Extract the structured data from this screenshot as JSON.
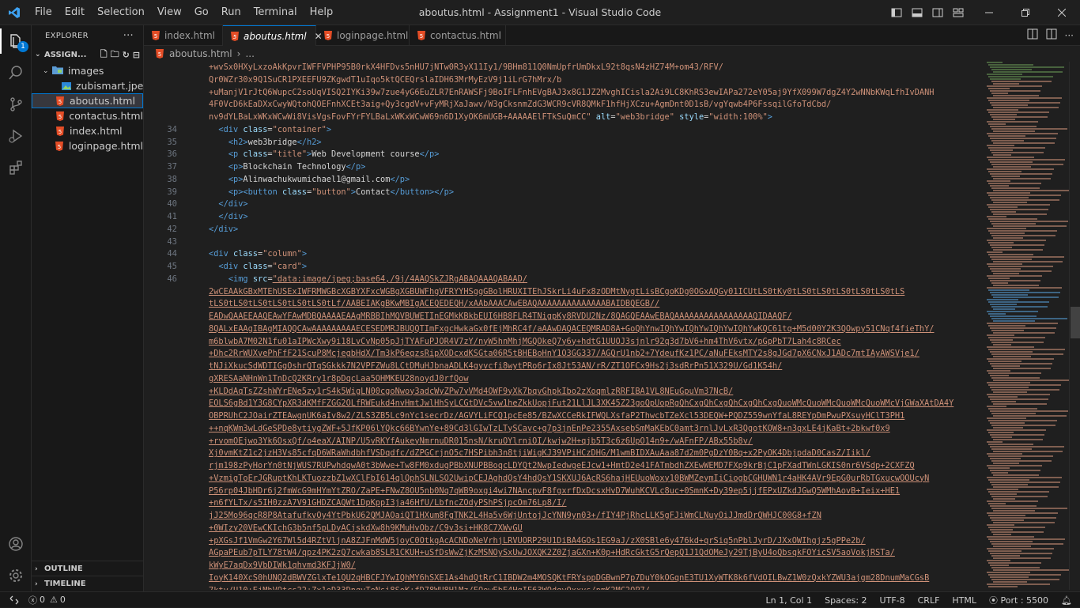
{
  "menu": [
    "File",
    "Edit",
    "Selection",
    "View",
    "Go",
    "Run",
    "Terminal",
    "Help"
  ],
  "window_title": "aboutus.html - Assignment1 - Visual Studio Code",
  "activitybar": {
    "badge": "1"
  },
  "explorer": {
    "header": "EXPLORER",
    "project": "ASSIGN...",
    "folder": "images",
    "items": [
      {
        "label": "zubismart.jpeg",
        "type": "image"
      },
      {
        "label": "aboutus.html",
        "type": "html",
        "selected": true
      },
      {
        "label": "contactus.html",
        "type": "html"
      },
      {
        "label": "index.html",
        "type": "html"
      },
      {
        "label": "loginpage.html",
        "type": "html"
      }
    ],
    "outline": "OUTLINE",
    "timeline": "TIMELINE"
  },
  "tabs": [
    {
      "label": "index.html",
      "active": false
    },
    {
      "label": "aboutus.html",
      "active": true
    },
    {
      "label": "loginpage.html",
      "active": false
    },
    {
      "label": "contactus.html",
      "active": false
    }
  ],
  "breadcrumb": {
    "file": "aboutus.html",
    "more": "..."
  },
  "code": {
    "lines": [
      {
        "n": "",
        "s": [
          [
            "str",
            "+wvSx0HXyLxzoAkKpvrIWFFVPHP95B0rkX4HFDvs5nHU7jNTw0R3yX11Iy1/9BHm811Q0NmUpfrUmDkxL92t8qsN4zHZ74M+om43/RFV/"
          ]
        ]
      },
      {
        "n": "",
        "s": [
          [
            "str",
            "Qr0WZr30x9Q1SuCR1PXEEFU9ZKgwdT1uIqo5ktQCEQrslaIDH63MrMyEzV9j1iLrG7hMrx/b"
          ]
        ]
      },
      {
        "n": "",
        "s": [
          [
            "str",
            "+uManjV1rJtQ6WupcC2soUqVISQ2IYKi39w7zue4yG6EuZLR7EnRAWSFj9BoIFLFnhEVgBAJ3x8G1JZ2MvghICisla2Ai9LC8KhRS3ewIAPa272eY05aj9YfX099W7dgZ4Y2wNNbKWqLfhIvDANH"
          ]
        ]
      },
      {
        "n": "",
        "s": [
          [
            "str",
            "4F0VcD6kEaDXxCwyWQtohQOEFnhXCEt3aig+Qy3cgdV+vFyMRjXaJawv/W3gCksnmZdG3WCR9cVR8QMkF1hfHjXCzu+AgmDnt0D1sB/vgYqwb4P6FssqilGfoTdCbd/"
          ]
        ]
      },
      {
        "n": "",
        "s": [
          [
            "str",
            "nv9dYLBaLxWKxWCwWi8VisVgsFovFYrFYLBaLxWKxWCwW69n6D1XyOK6mUGB+AAAAAElFTkSuQmCC\""
          ],
          [
            "att",
            " alt"
          ],
          [
            "txt",
            "="
          ],
          [
            "str",
            "\"web3bridge\""
          ],
          [
            "att",
            " style"
          ],
          [
            "txt",
            "="
          ],
          [
            "str",
            "\"width:100%\""
          ],
          [
            "tag",
            ">"
          ]
        ]
      },
      {
        "n": "34",
        "s": [
          [
            "txt",
            "  "
          ],
          [
            "tag",
            "<div"
          ],
          [
            "att",
            " class"
          ],
          [
            "txt",
            "="
          ],
          [
            "str",
            "\"container\""
          ],
          [
            "tag",
            ">"
          ]
        ]
      },
      {
        "n": "35",
        "s": [
          [
            "txt",
            "    "
          ],
          [
            "tag",
            "<h2>"
          ],
          [
            "txt",
            "web3bridge"
          ],
          [
            "tag",
            "</h2>"
          ]
        ]
      },
      {
        "n": "36",
        "s": [
          [
            "txt",
            "    "
          ],
          [
            "tag",
            "<p"
          ],
          [
            "att",
            " class"
          ],
          [
            "txt",
            "="
          ],
          [
            "str",
            "\"title\""
          ],
          [
            "tag",
            ">"
          ],
          [
            "txt",
            "Web Development course"
          ],
          [
            "tag",
            "</p>"
          ]
        ]
      },
      {
        "n": "37",
        "s": [
          [
            "txt",
            "    "
          ],
          [
            "tag",
            "<p>"
          ],
          [
            "txt",
            "Blockchain Technology"
          ],
          [
            "tag",
            "</p>"
          ]
        ]
      },
      {
        "n": "38",
        "s": [
          [
            "txt",
            "    "
          ],
          [
            "tag",
            "<p>"
          ],
          [
            "txt",
            "Alinwachukwumichael1@gmail.com"
          ],
          [
            "tag",
            "</p>"
          ]
        ]
      },
      {
        "n": "39",
        "s": [
          [
            "txt",
            "    "
          ],
          [
            "tag",
            "<p><button"
          ],
          [
            "att",
            " class"
          ],
          [
            "txt",
            "="
          ],
          [
            "str",
            "\"button\""
          ],
          [
            "tag",
            ">"
          ],
          [
            "txt",
            "Contact"
          ],
          [
            "tag",
            "</button></p>"
          ]
        ]
      },
      {
        "n": "40",
        "s": [
          [
            "txt",
            "  "
          ],
          [
            "tag",
            "</div>"
          ]
        ]
      },
      {
        "n": "41",
        "s": [
          [
            "txt",
            "  "
          ],
          [
            "tag",
            "</div>"
          ]
        ]
      },
      {
        "n": "42",
        "s": [
          [
            "txt",
            ""
          ],
          [
            "tag",
            "</div>"
          ]
        ]
      },
      {
        "n": "43",
        "s": [
          [
            "txt",
            ""
          ]
        ]
      },
      {
        "n": "44",
        "s": [
          [
            "txt",
            ""
          ],
          [
            "tag",
            "<div"
          ],
          [
            "att",
            " class"
          ],
          [
            "txt",
            "="
          ],
          [
            "str",
            "\"column\""
          ],
          [
            "tag",
            ">"
          ]
        ]
      },
      {
        "n": "45",
        "s": [
          [
            "txt",
            "  "
          ],
          [
            "tag",
            "<div"
          ],
          [
            "att",
            " class"
          ],
          [
            "txt",
            "="
          ],
          [
            "str",
            "\"card\""
          ],
          [
            "tag",
            ">"
          ]
        ]
      },
      {
        "n": "46",
        "s": [
          [
            "txt",
            "    "
          ],
          [
            "tag",
            "<img"
          ],
          [
            "att",
            " src"
          ],
          [
            "txt",
            "="
          ],
          [
            "ulink",
            "\"data:image/jpeg;base64,/9j/4AAQSkZJRgABAQAAAQABAAD/"
          ]
        ]
      },
      {
        "n": "",
        "s": [
          [
            "ulink",
            "2wCEAAkGBxMTEhUSExIWFRMWGBcXGBYXFxcWGBgXGBUWFhgVFRYYHSggGBolHRUXITEhJSkrLi4uFx8zODMtNygtLisBCgoKDg0OGxAQGy01ICUtLS0tKy0tLS0tLS0tLS0tLS0tLS0tLS"
          ]
        ]
      },
      {
        "n": "",
        "s": [
          [
            "ulink",
            "tLS0tLS0tLS0tLS0tLS0tLS0tLf/AABEIAKgBKwMBIgACEQEDEQH/xAAbAAACAwEBAQAAAAAAAAAAAAAABAIDBQEGB//"
          ]
        ]
      },
      {
        "n": "",
        "s": [
          [
            "ulink",
            "EADwQAAEEAAQEAwYFAwMDBQAAAAEAAgMRBBIhMQVBUWETInEGMkKBkbEUI6HB8FLR4TNigpKy8RVDU2Nz/8QAGQEAAwEBAQAAAAAAAAAAAAAAAAQIDAAQF/"
          ]
        ]
      },
      {
        "n": "",
        "s": [
          [
            "ulink",
            "8QALxEAAgIBAgMIAQQCAwAAAAAAAAAECESEDMRJBUQQTImFxgcHwkaGx0fEjMhRC4f/aAAwDAQACEQMRAD8A+GoQhYnwIQhYwIQhYwIQhYwIQhYwKQC61tq+M5d00Y2K3QOwpy51CNqf4fieThY/"
          ]
        ]
      },
      {
        "n": "",
        "s": [
          [
            "ulink",
            "m6blwbA7M02N1fu01aIPWcXwy9i18LvCvNp05pJjTYAFuPJOR4V7zY/nyW5hnMhjMGQOkeQ7y6y+hdtG1UUOJ3sjnlr92q3d7bV6+hm4ThV6vtx/pGpPbT7Lah4c8RCec"
          ]
        ]
      },
      {
        "n": "",
        "s": [
          [
            "ulink",
            "+Dhc2RrWUXvePhFfF21ScuP8McjegbHdX/Tm3kP6eqzsRipXODcxdKSGta06R5tBHEBoHnY1O3GG337/AGQrU1nb2+7YdeufKz1PC/aNuFEksMTY2s8gJGd7pX6CNxJ1ADc7mtIAyAWSVje1/"
          ]
        ]
      },
      {
        "n": "",
        "s": [
          [
            "ulink",
            "tNJiXkucSdWDTIGgOshrQTqSGkkk7N2VPFZWu8LCtDMuHJbnaADLK4gyvcfi8wytPRo6rIx8Jt53AN/rR/ZT1OFCx9Hs2j3sdRrPn51X329U/Gd1K54h/"
          ]
        ]
      },
      {
        "n": "",
        "s": [
          [
            "ulink",
            "gXRESAaNHnWn1TnDcQ2KRry1r8pDqcLaa5OHMKEU28noydJ0rfQow"
          ]
        ]
      },
      {
        "n": "",
        "s": [
          [
            "ulink",
            "+KLDdAqTsZZshWYrENe5zy1rS4k5WigLN00cgoNwoy3adcWyZPw7yVMd4OWF9yXk7bqvGhpkIbo2zXoqmlzRRFIBA1VL8NEuGpuVm37NcB/"
          ]
        ]
      },
      {
        "n": "",
        "s": [
          [
            "ulink",
            "EOLS6gBd1Y3G8CYpXR3dKMfFZGG2OLfRWEukd4nvHmtJwlHhSyLCGtDVc5vw1heZkkUopjFut21LlJL3XK45Z23goQpUopRgQhCxgQhCxgQhCxgQhCxgQuoWMcQuoWMcQuoWMcQuoWMcVjGWaXAtDA4Y"
          ]
        ]
      },
      {
        "n": "",
        "s": [
          [
            "ulink",
            "OBPRUhC2JOairZTEAwgnUK6aIv8w2/ZLS3ZB5Lc9nYc1secrDz/AGVYLiFCQ1pcEe85/BZwXCCeRkIFWQLXsfaP2ThwcbTZeXcl53DEQW+PQDZ559wnYfaL8REYpDmPwuPXsuyHClT3PH1"
          ]
        ]
      },
      {
        "n": "",
        "s": [
          [
            "ulink",
            "++nqKWm3wLdGeSPDe8ytiygZWF+5JfKP06lYQkc66BYwnYe+89Cd3lGIwTzLTySCavc+g7p3jnEnPe2355AxsebSmMaKEbC0amt3rnlJvLxR3QgotKOW8+n3qxLE4jKaBt+2bkwf0x9"
          ]
        ]
      },
      {
        "n": "",
        "s": [
          [
            "ulink",
            "+rvomOEjwo3Yk6OsxQf/o4eaX/AINP/U5vRKYfAukeyNmrnuDR015nsN/kruOYlrniOI/kwjw2H+qjb5T3c6z6UpO14n9+/wAFnFP/ABx55b8v/"
          ]
        ]
      },
      {
        "n": "",
        "s": [
          [
            "ulink",
            "Xj0vmKtZ1c2jzH3Vs85cfqD6WRaWhdbhfVSDqdfc/dZPGCrjnO5c7HSPibh3n8tjiWigKJ39VPiHCzDHG/M1wmBIDXAuAaa87d2m0PgDzY0Bq+x2PyOK4DbjpdaD0CasZ/Iikl/"
          ]
        ]
      },
      {
        "n": "",
        "s": [
          [
            "ulink",
            "rjm198zPyHorYn0tNjWUS7RUPwhdqwA0t3bWwe+Tw8FM0xdugPBbXNUPBBoqcLDYQt2NwpIedwgeEJcw1+HmtD2e41FATmbdhZXEwWEMD7FXp9krBjC1pFXadTWnLGKIS0nr6VSdp+2CXFZQ"
          ]
        ]
      },
      {
        "n": "",
        "s": [
          [
            "ulink",
            "+VzmigToErJGRuptKhLKTuozzbZ1wXClFbI614qlQphSLNLSO2UwipCEJAghdQsY4hdQsY1SKXUJ6AcRS6hajHEUuoWoxy10BWMZeymIiCiogbCGHUWN1r4aHK4AVr9EpG0urRbTGxucwOOUcyN"
          ]
        ]
      },
      {
        "n": "",
        "s": [
          [
            "ulink",
            "P56rp04JbHDr6j2fmWcG9mHYmYtZRO/ZaPE+FNwZ8OU5nb0Nq7qWB9oxgi4wi7NAncpvF8fgxrfDxDcsxHvD7WuhKCVLc8uc+0SmnK+Dy39ep5jjfEPxUZkdJGwQ5WMhAovB+Ieix+HE1"
          ]
        ]
      },
      {
        "n": "",
        "s": [
          [
            "ulink",
            "+n6fYLTx/s5IH0zzA7V91GHDZCAQWt1DpKppI3ja46HfU/LbfncZOdyPShPSjpcOm76Lp8/I/"
          ]
        ]
      },
      {
        "n": "",
        "s": [
          [
            "ulink",
            "jJ25Mo96qcR8P8AtafufkvOy4YtPbkU62QMJAOaiQT1HXum8FgTNK2L4Ha5v6WjUntojJcYNN9yn03+/fIY4PjRhcLLK5gFJiWmCLNuyOiJJmdDrQWHJC00G8+fZN"
          ]
        ]
      },
      {
        "n": "",
        "s": [
          [
            "ulink",
            "+0WIzy20VEwCKIchG3b5nf5pLDyACjskdXw8h9KMuHvObz/C9v3si+HK8C7XWvGU"
          ]
        ]
      },
      {
        "n": "",
        "s": [
          [
            "ulink",
            "+pXGsJf1VmGw2Y67Wl5d4RZtVljnA8ZJFnMdW5joyC0OtkgAcACNDoNeVrhjLRVUORP29U1DiBA4GOs1EG9aJ/zX0SBle6y476kd+qrSiq5nPblJyrD/JXxOWIhgjz5gPPe2b/"
          ]
        ]
      },
      {
        "n": "",
        "s": [
          [
            "ulink",
            "AGpaPEub7pTLY78tW4/qpz4PK2zQ7cwkab8SLR1CKUH+uSfDsWwZjKzMSNOySxUwJOXQK2Z0ZjaGXn+K0p+HdRcGktG5rQepQ1J1QdOMeJy29TjByU4oQbsqkFOYicSV5aoVokjRSTa/"
          ]
        ]
      },
      {
        "n": "",
        "s": [
          [
            "ulink",
            "kWyE7aqDx9VbDIWk1qhvmd3KFJjW0/"
          ]
        ]
      },
      {
        "n": "",
        "s": [
          [
            "ulink",
            "IoyK140XcS0hUNQ2dBWVZGlxTe1QU2qHBCFJYwIQhMY6hSXE1As4hdQtRrC1IBDW2m4MOSQKtFRYsppDGBwnP7p7DuY0kOGqnE3TU1XyWTK8k6fVdOILBwZ1W0zQxkYZWU3ajgm28DnumMaCGsB"
          ]
        ]
      },
      {
        "n": "",
        "s": [
          [
            "ulink",
            "7ktv/U10+EjMhVOtcs22+Zx1eD33DngvToNsi8SoK+fD78WU8HlMz/EOowEbE4HqIE63WQdqyOxxvs/pmK2MC2OP7/"
          ]
        ]
      }
    ]
  },
  "status": {
    "errors": "0",
    "warnings": "0",
    "position": "Ln 1, Col 1",
    "spaces": "Spaces: 2",
    "encoding": "UTF-8",
    "eol": "CRLF",
    "language": "HTML",
    "port": "Port : 5500"
  },
  "colors": {
    "accent": "#0078d4",
    "html_icon": "#e44d26",
    "folder_icon": "#5b9bd5"
  }
}
